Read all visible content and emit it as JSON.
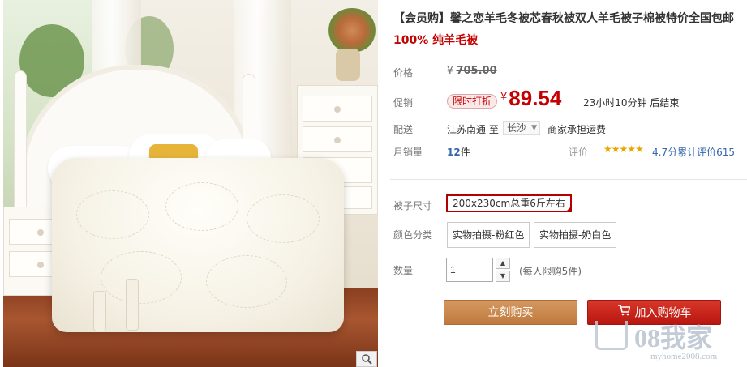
{
  "product": {
    "title": "【会员购】馨之恋羊毛冬被芯春秋被双人羊毛被子棉被特价全国包邮",
    "subtitle": "100% 纯羊毛被"
  },
  "labels": {
    "price": "价格",
    "promo": "促销",
    "shipping": "配送",
    "monthly_sales": "月销量",
    "quilt_size": "被子尺寸",
    "color_category": "颜色分类",
    "quantity": "数量"
  },
  "price": {
    "currency": "¥",
    "original": "705.00",
    "promo_tag": "限时打折",
    "current": "89.54",
    "countdown": "23小时10分钟 后结束"
  },
  "shipping": {
    "from": "江苏南通",
    "to_word": "至",
    "destination": "长沙",
    "fee_note": "商家承担运费"
  },
  "sales": {
    "count": "12",
    "unit": "件",
    "rating_label": "评价",
    "stars": "★★★★★",
    "rating_text": "4.7分累计评价615"
  },
  "options": {
    "sizes": [
      "200x230cm总重6斤左右"
    ],
    "selected_size": "200x230cm总重6斤左右",
    "colors": [
      "实物拍摄-粉红色",
      "实物拍摄-奶白色"
    ]
  },
  "quantity": {
    "value": "1",
    "limit_note": "(每人限购5件)"
  },
  "buttons": {
    "buy_now": "立刻购买",
    "add_to_cart": "加入购物车"
  },
  "watermark": {
    "logo": "08我家",
    "url": "myhome2008.com"
  },
  "colors": {
    "price_red": "#c40000",
    "buy_button": "#c8864a",
    "cart_button": "#c8241a"
  },
  "icons": {
    "zoom": "magnifier-icon",
    "cart": "cart-icon",
    "dropdown": "triangle-down-icon"
  }
}
